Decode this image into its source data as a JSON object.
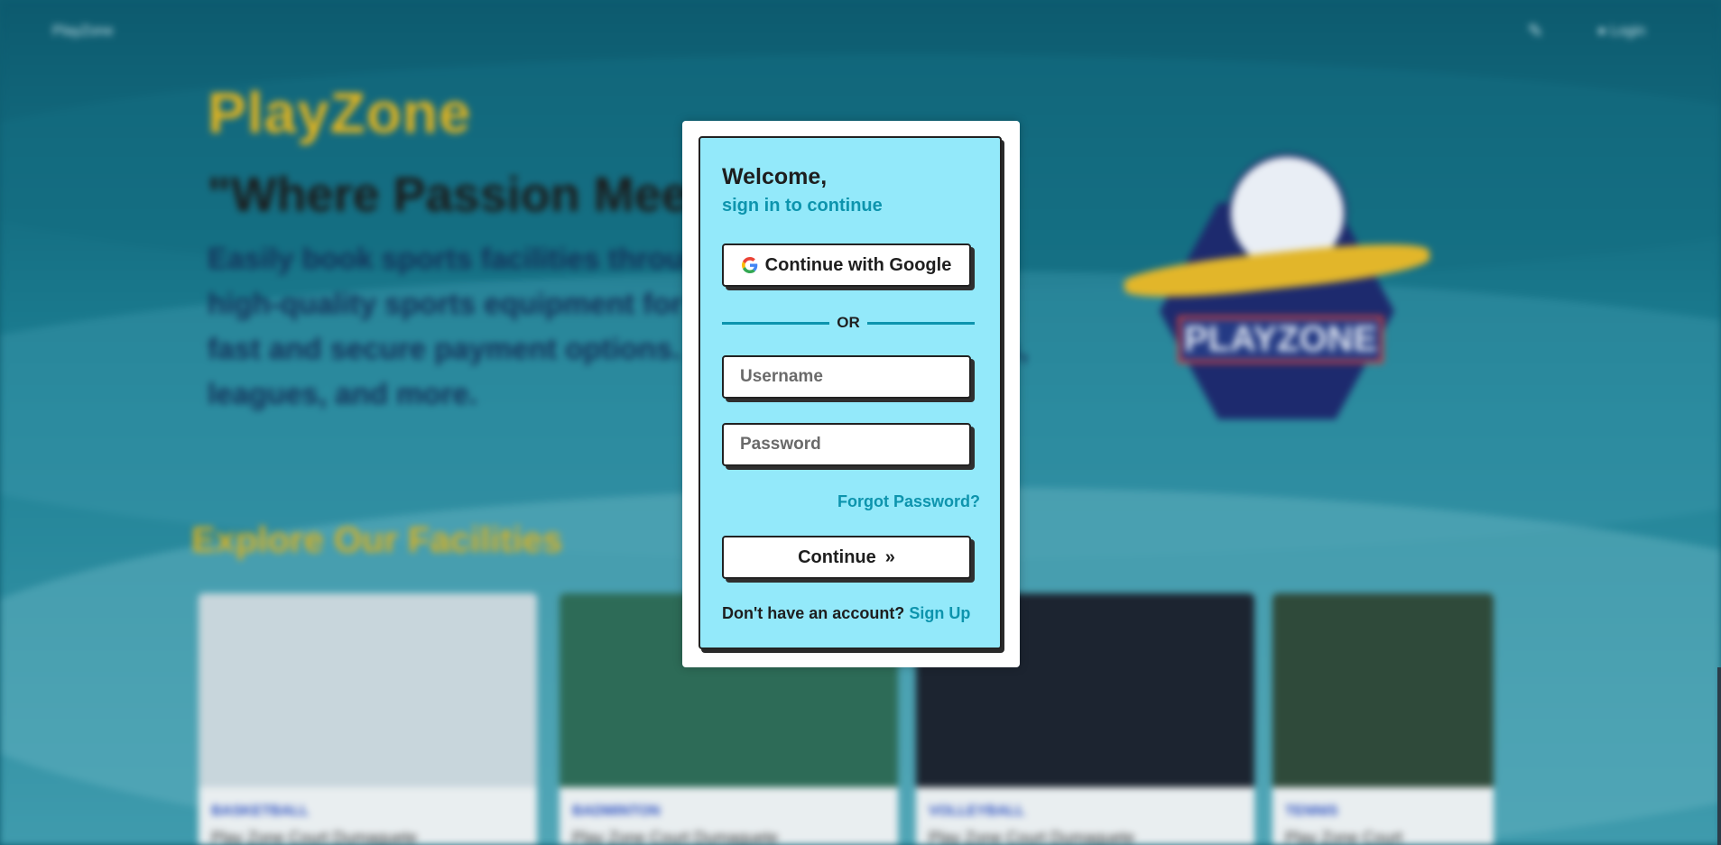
{
  "background_page": {
    "nav": {
      "brand": "PlayZone",
      "login_label": "Login"
    },
    "hero": {
      "brand": "PlayZone",
      "tagline": "\"Where Passion Meets Play\"",
      "description": "Easily book sports facilities through our platform, rent high-quality sports equipment for your games, and enjoy fast and secure payment options. Join community events, leagues, and more."
    },
    "logo_text": "PLAYZONE",
    "section_title": "Explore Our Facilities",
    "facilities": [
      {
        "category": "BASKETBALL",
        "name": "Play Zone Court Dumaguete",
        "image_color": "#c8d6dc"
      },
      {
        "category": "BADMINTON",
        "name": "Play Zone Court Dumaguete",
        "image_color": "#2d6b57"
      },
      {
        "category": "VOLLEYBALL",
        "name": "Play Zone Court Dumaguete",
        "image_color": "#1c2430"
      },
      {
        "category": "TENNIS",
        "name": "Play Zone Court Dumaguete",
        "image_color": "#2f4a3a"
      }
    ]
  },
  "login": {
    "welcome": "Welcome,",
    "subtitle": "sign in to continue",
    "google_button": "Continue with Google",
    "google_icon": "google-g-icon",
    "divider_text": "OR",
    "username_placeholder": "Username",
    "password_placeholder": "Password",
    "forgot_password": "Forgot Password?",
    "continue_button": "Continue",
    "continue_icon": "»",
    "no_account_text": "Don't have an account?",
    "signup_link": "Sign Up"
  },
  "colors": {
    "modal_bg": "#93e9fa",
    "accent": "#0d94ad",
    "brand_yellow": "#e0b320"
  }
}
